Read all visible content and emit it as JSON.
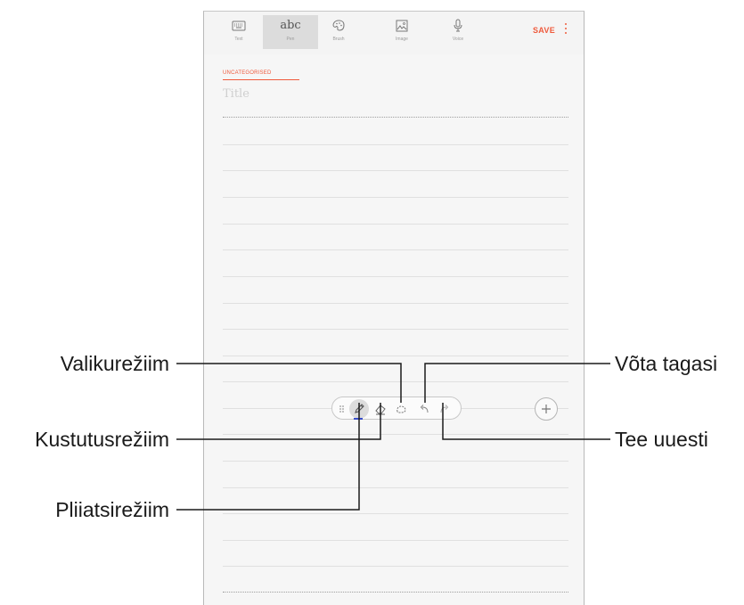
{
  "toolbar": {
    "tools": [
      {
        "label": "Text",
        "icon": "keyboard-icon"
      },
      {
        "label": "Pen",
        "icon": "abc-text-icon",
        "glyph": "abc",
        "active": true
      },
      {
        "label": "Brush",
        "icon": "palette-icon"
      },
      {
        "label": "Image",
        "icon": "image-icon"
      },
      {
        "label": "Voice",
        "icon": "microphone-icon"
      }
    ],
    "save_label": "SAVE",
    "more_icon": "more-vert-icon"
  },
  "note": {
    "category": "UNCATEGORISED",
    "title_placeholder": "Title"
  },
  "pen_toolbar": {
    "items": [
      "drag-handle-icon",
      "pen-icon",
      "eraser-icon",
      "lasso-select-icon",
      "undo-icon",
      "redo-icon"
    ],
    "add_icon": "plus-icon"
  },
  "callouts": {
    "selection_mode": "Valikurežiim",
    "eraser_mode": "Kustutusrežiim",
    "pen_mode": "Pliiatsirežiim",
    "undo": "Võta tagasi",
    "redo": "Tee uuesti"
  },
  "colors": {
    "accent": "#ef5a3c",
    "pen_underline": "#3a4ec8",
    "callout_line": "#1a1a1a"
  }
}
